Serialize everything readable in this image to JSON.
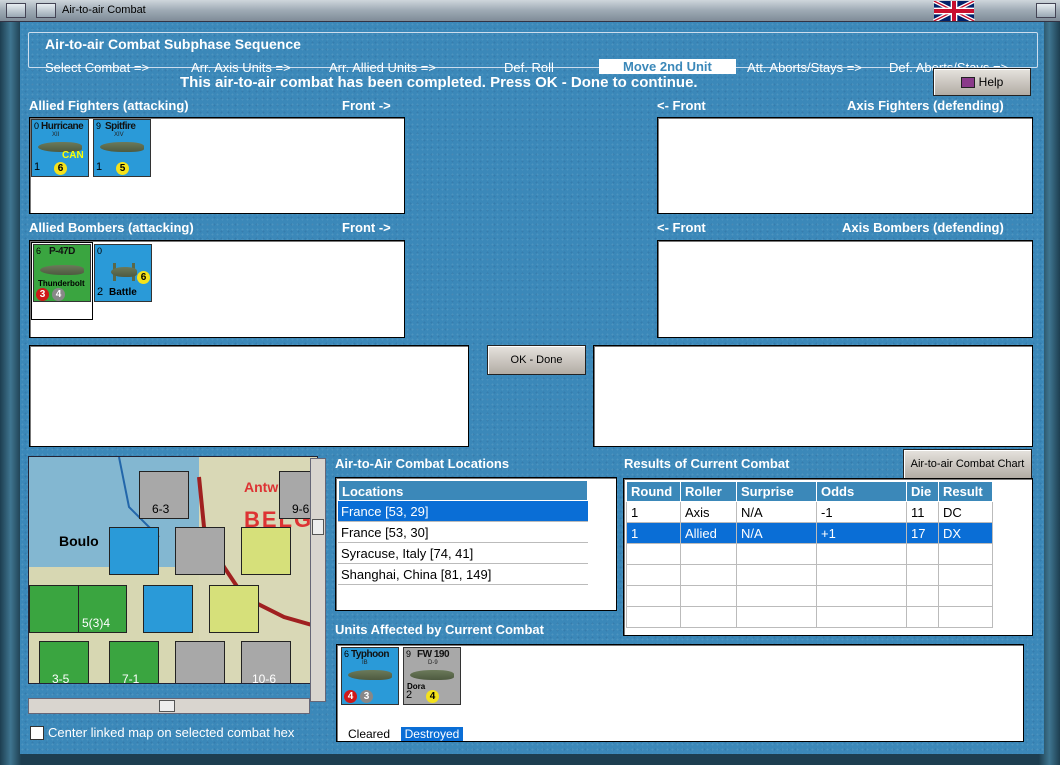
{
  "window": {
    "title": "Air-to-air Combat"
  },
  "sequence": {
    "title": "Air-to-air Combat Subphase Sequence",
    "steps": [
      "Select Combat =>",
      "Arr. Axis Units =>",
      "Arr. Allied Units =>",
      "Def. Roll",
      "Move 2nd Unit",
      "Att. Aborts/Stays =>",
      "Def. Aborts/Stays =>"
    ],
    "active_index": 4
  },
  "status_message": "This air-to-air combat has been completed.  Press OK - Done to continue.",
  "buttons": {
    "help": "Help",
    "ok_done": "OK - Done",
    "chart": "Air-to-air Combat Chart"
  },
  "sections": {
    "allied_fighters": "Allied Fighters (attacking)",
    "axis_fighters": "Axis Fighters (defending)",
    "allied_bombers": "Allied Bombers (attacking)",
    "axis_bombers": "Axis Bombers (defending)",
    "front_right": "Front ->",
    "front_left": "<- Front"
  },
  "allied_fighter_units": [
    {
      "name": "Hurricane",
      "sub": "XII",
      "tl": "0",
      "bl": "1",
      "val": "6",
      "nat": "CAN",
      "color": "#2a9ad8"
    },
    {
      "name": "Spitfire",
      "sub": "XIV",
      "tl": "9",
      "bl": "1",
      "val": "5",
      "nat": "",
      "color": "#2a9ad8"
    }
  ],
  "allied_bomber_units": [
    {
      "name": "P-47D",
      "sub": "Thunderbolt",
      "tl": "6",
      "bl": "",
      "val": "4",
      "red": "3",
      "color": "#3aa540"
    },
    {
      "name": "Battle",
      "sub": "",
      "tl": "0",
      "bl": "2",
      "val": "6",
      "color": "#2a9ad8"
    }
  ],
  "locations": {
    "title": "Air-to-Air Combat Locations",
    "header": "Locations",
    "items": [
      "France [53, 29]",
      "France [53, 30]",
      "Syracuse, Italy [74, 41]",
      "Shanghai, China [81, 149]"
    ],
    "selected_index": 0
  },
  "results": {
    "title": "Results of Current Combat",
    "columns": [
      "Round",
      "Roller",
      "Surprise",
      "Odds",
      "Die",
      "Result"
    ],
    "rows": [
      [
        "1",
        "Axis",
        "N/A",
        "-1",
        "11",
        "DC"
      ],
      [
        "1",
        "Allied",
        "N/A",
        "+1",
        "17",
        "DX"
      ]
    ],
    "selected_index": 1
  },
  "affected": {
    "title": "Units Affected by Current Combat",
    "units": [
      {
        "name": "Typhoon",
        "sub": "IB",
        "status": "Cleared",
        "red": "4",
        "grey": "3",
        "tl": "6"
      },
      {
        "name": "FW 190",
        "sub": "D-9",
        "status": "Destroyed",
        "tl": "9",
        "bl": "2",
        "val": "4",
        "nat": "Dora"
      }
    ]
  },
  "map": {
    "labels": [
      "Antw",
      "BELG",
      "Boulo"
    ],
    "counters": [
      "6-3",
      "9-6",
      "5(3)4",
      "3-5",
      "7-1",
      "10-6"
    ],
    "center_checkbox": "Center linked map on selected combat hex"
  },
  "colors": {
    "panel": "#3b88b9",
    "selection": "#0a6ed6"
  }
}
